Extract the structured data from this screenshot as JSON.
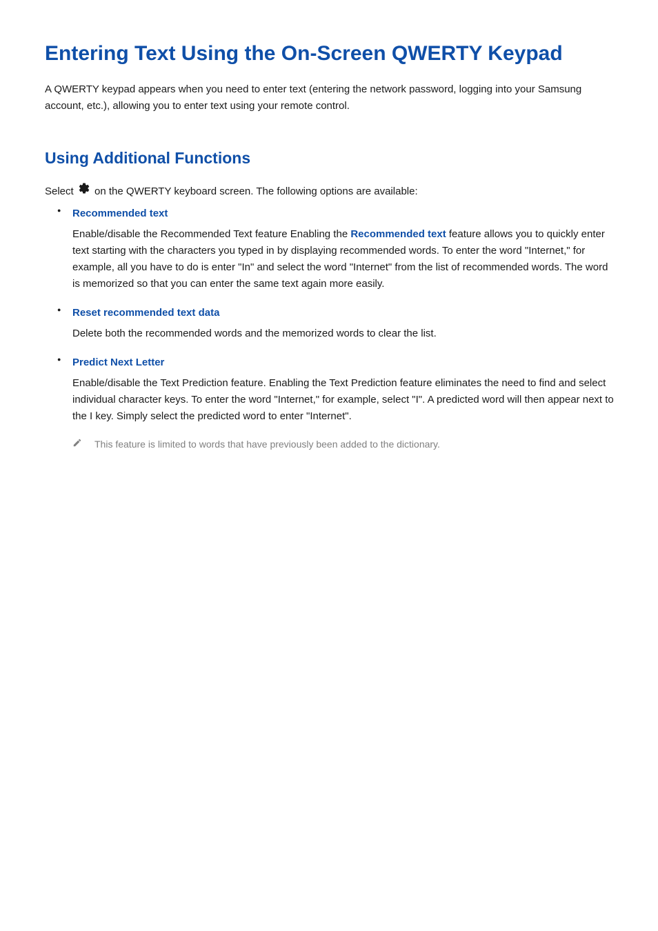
{
  "title": "Entering Text Using the On-Screen QWERTY Keypad",
  "intro": "A QWERTY keypad appears when you need to enter text (entering the network password, logging into your Samsung account, etc.), allowing you to enter text using your remote control.",
  "subtitle": "Using Additional Functions",
  "select_prefix": "Select ",
  "select_suffix": " on the QWERTY keyboard screen. The following options are available:",
  "items": [
    {
      "title": "Recommended text",
      "body_pre": "Enable/disable the Recommended Text feature Enabling the ",
      "body_highlight": "Recommended text",
      "body_post": " feature allows you to quickly enter text starting with the characters you typed in by displaying recommended words. To enter the word \"Internet,\" for example, all you have to do is enter \"In\" and select the word \"Internet\" from the list of recommended words. The word is memorized so that you can enter the same text again more easily."
    },
    {
      "title": "Reset recommended text data",
      "body_pre": "Delete both the recommended words and the memorized words to clear the list.",
      "body_highlight": "",
      "body_post": ""
    },
    {
      "title": "Predict Next Letter",
      "body_pre": "Enable/disable the Text Prediction feature. Enabling the Text Prediction feature eliminates the need to find and select individual character keys. To enter the word \"Internet,\" for example, select \"I\". A predicted word will then appear next to the I key. Simply select the predicted word to enter \"Internet\".",
      "body_highlight": "",
      "body_post": ""
    }
  ],
  "note": "This feature is limited to words that have previously been added to the dictionary."
}
